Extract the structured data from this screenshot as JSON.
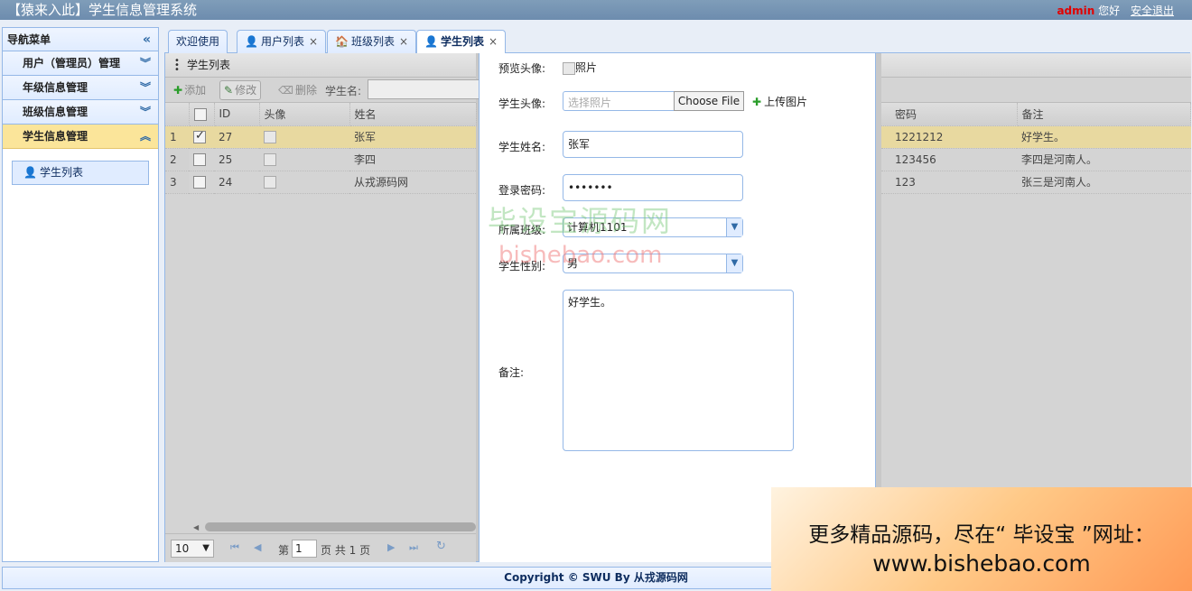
{
  "header": {
    "title": "【猿来入此】学生信息管理系统",
    "username": "admin",
    "greeting": "您好",
    "logout": "安全退出"
  },
  "sidebar": {
    "title": "导航菜单",
    "items": [
      {
        "label": "用户（管理员）管理"
      },
      {
        "label": "年级信息管理"
      },
      {
        "label": "班级信息管理"
      },
      {
        "label": "学生信息管理"
      }
    ],
    "sub_item": "学生列表"
  },
  "tabs": [
    {
      "label": "欢迎使用"
    },
    {
      "label": "用户列表"
    },
    {
      "label": "班级列表"
    },
    {
      "label": "学生列表"
    }
  ],
  "panel": {
    "title": "学生列表",
    "toolbar": {
      "add": "添加",
      "edit": "修改",
      "delete": "删除",
      "search_label": "学生名:"
    }
  },
  "grid": {
    "columns_left": [
      "ID",
      "头像",
      "姓名"
    ],
    "columns_right": [
      "密码",
      "备注"
    ],
    "rows": [
      {
        "num": "1",
        "id": "27",
        "name": "张军",
        "password": "1221212",
        "note": "好学生。",
        "checked": true
      },
      {
        "num": "2",
        "id": "25",
        "name": "李四",
        "password": "123456",
        "note": "李四是河南人。",
        "checked": false
      },
      {
        "num": "3",
        "id": "24",
        "name": "从戎源码网",
        "password": "123",
        "note": "张三是河南人。",
        "checked": false
      }
    ]
  },
  "pager": {
    "page_size": "10",
    "page_prefix": "第",
    "page_value": "1",
    "page_suffix": "页 共 1 页"
  },
  "dialog": {
    "preview_label": "预览头像:",
    "preview_alt": "照片",
    "avatar_label": "学生头像:",
    "avatar_placeholder": "选择照片",
    "choose_file": "Choose File",
    "upload": "上传图片",
    "name_label": "学生姓名:",
    "name_value": "张军",
    "password_label": "登录密码:",
    "password_value": "•••••••",
    "class_label": "所属班级:",
    "class_value": "计算机1101",
    "gender_label": "学生性别:",
    "gender_value": "男",
    "note_label": "备注:",
    "note_value": "好学生。"
  },
  "watermark": {
    "line1": "毕设宝源码网",
    "line2": "bishebao.com"
  },
  "footer": {
    "copyright": "Copyright © SWU By 从戎源码网"
  },
  "ad": {
    "line1": "更多精品源码，尽在“ 毕设宝 ”网址：",
    "line2": "www.bishebao.com"
  }
}
